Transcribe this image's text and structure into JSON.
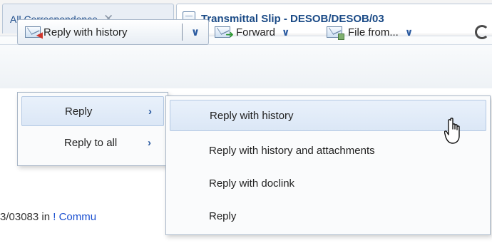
{
  "tabs": [
    {
      "label": "All Correspondence",
      "close_glyph": "✕",
      "state": "inactive"
    },
    {
      "label": "Transmittal Slip - DESOB/DESOB/03",
      "icon": "document-icon",
      "state": "active"
    }
  ],
  "toolbar": {
    "reply_split_label": "Reply with history",
    "reply_split_arrow": "∨",
    "forward_label": "Forward",
    "forward_arrow": "∨",
    "file_from_label": "File from...",
    "file_from_arrow": "∨"
  },
  "menu_level1": {
    "items": [
      {
        "label": "Reply",
        "arrow": "›",
        "highlighted": true
      },
      {
        "label": "Reply to all",
        "arrow": "›",
        "highlighted": false
      }
    ]
  },
  "menu_level2": {
    "items": [
      {
        "label": "Reply with history",
        "highlighted": true
      },
      {
        "label": "Reply with history and attachments",
        "highlighted": false
      },
      {
        "label": "Reply with doclink",
        "highlighted": false
      },
      {
        "label": "Reply",
        "highlighted": false
      }
    ]
  },
  "content": {
    "line_prefix": "3/03083 in ",
    "excl": "!",
    "link_text": " Commu"
  },
  "colors": {
    "accent": "#2a5aa0",
    "highlight": "#dbe7f6",
    "link": "#1a4fd0"
  }
}
